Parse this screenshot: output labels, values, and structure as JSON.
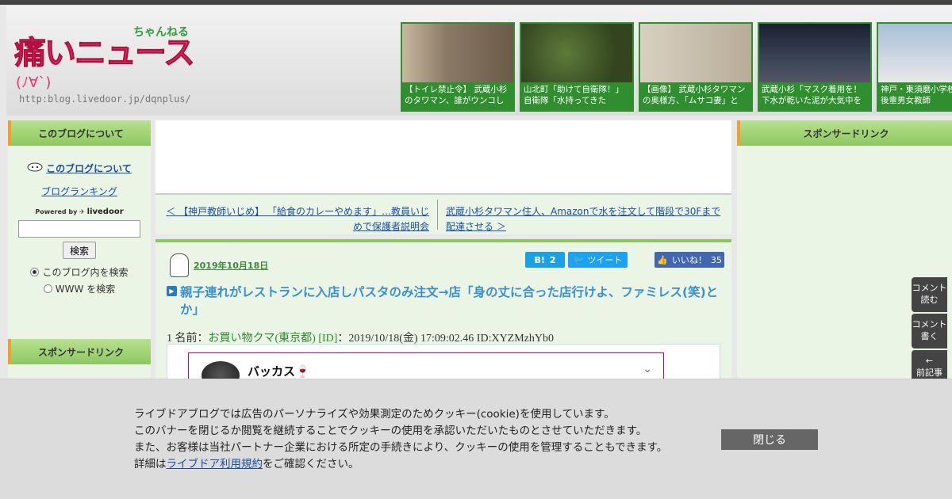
{
  "header": {
    "logo": {
      "main_text": "痛いニュース",
      "channel_text": "ちゃんねる",
      "face": "(ﾉ∀`)",
      "url": "http:blog.livedoor.jp/dqnplus/"
    },
    "thumbnails": [
      {
        "caption": "【トイレ禁止令】 武蔵小杉のタワマン、誰がウンコし"
      },
      {
        "caption": "山北町「助けて自衛隊！」 自衛隊「水持ってきた"
      },
      {
        "caption": "【画像】 武蔵小杉タワマンの奥様方、「ムサコ妻」と"
      },
      {
        "caption": "武蔵小杉「マスク着用を！下水が乾いた泥が大気中を"
      },
      {
        "caption": "神戸・東須磨小学校教師、後輩男女教師"
      }
    ]
  },
  "left_sidebar": {
    "about_heading": "このブログについて",
    "about_link": "このブログについて",
    "ranking_link": "ブログランキング",
    "powered_by": "Powered by",
    "powered_brand": "livedoor",
    "search_button": "検索",
    "radio_blog": "このブログ内を検索",
    "radio_www": "WWW を検索",
    "sponsor_heading": "スポンサードリンク"
  },
  "right_sidebar": {
    "sponsor_heading": "スポンサードリンク"
  },
  "nav": {
    "prev": "＜ 【神戸教師いじめ】 「給食のカレーやめます」…教員いじめで保護者説明会",
    "next": "武蔵小杉タワマン住人、Amazonで水を注文して階段で30Fまで配達させる ＞"
  },
  "article": {
    "date": "2019年10月18日",
    "hatena_label": "B!",
    "hatena_count": "2",
    "tweet_label": "ツイート",
    "like_label": "いいね！",
    "like_count": "35",
    "title": "親子連れがレストランに入店しパスタのみ注文→店「身の丈に合った店行けよ、ファミレス(笑)とか」",
    "post_num": "1 名前：",
    "post_name": "お買い物クマ(東京都) [ID]",
    "post_meta": "：2019/10/18(金) 17:09:02.46 ID:XYZMzhYb0",
    "tweet_user": "バッカス🍷"
  },
  "side_tabs": {
    "read_comments": "コメント読む",
    "write_comment": "コメント書く",
    "prev_article": "前記事"
  },
  "cookie": {
    "line1": "ライブドアブログでは広告のパーソナライズや効果測定のためクッキー(cookie)を使用しています。",
    "line2": "このバナーを閉じるか閲覧を継続することでクッキーの使用を承認いただいたものとさせていただきます。",
    "line3": "また、お客様は当社パートナー企業における所定の手続きにより、クッキーの使用を管理することもできます。",
    "line4_prefix": "詳細は",
    "line4_link": "ライブドア利用規約",
    "line4_suffix": "をご確認ください。",
    "close": "閉じる"
  }
}
